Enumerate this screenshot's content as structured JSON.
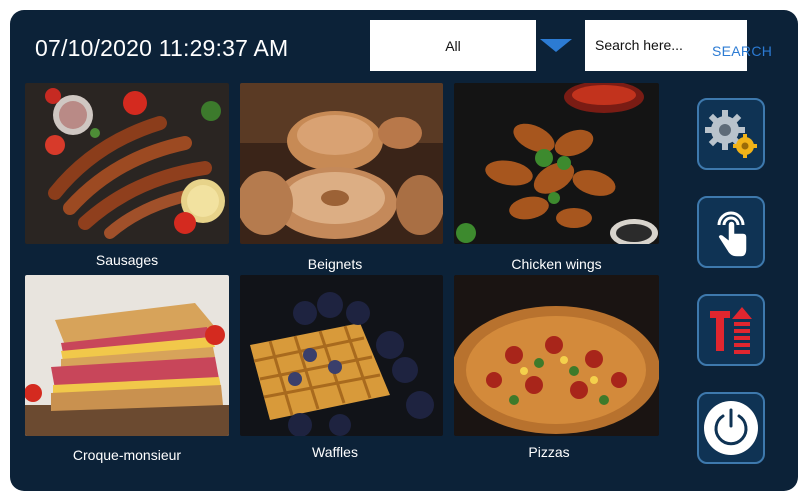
{
  "header": {
    "datetime": "07/10/2020 11:29:37 AM",
    "category_select": "All",
    "search_placeholder": "Search here...",
    "search_button": "SEARCH"
  },
  "menu_items": [
    {
      "label": "Sausages"
    },
    {
      "label": "Beignets"
    },
    {
      "label": "Chicken wings"
    },
    {
      "label": "Croque-monsieur"
    },
    {
      "label": "Waffles"
    },
    {
      "label": "Pizzas"
    }
  ],
  "side_buttons": [
    {
      "icon": "settings-gears-icon"
    },
    {
      "icon": "touch-hand-icon"
    },
    {
      "icon": "text-size-icon"
    },
    {
      "icon": "power-icon"
    }
  ],
  "colors": {
    "background": "#0c2238",
    "accent": "#2c7bd3",
    "button_border": "#3e79ad",
    "button_fill": "#0f3354",
    "text_size_icon": "#e0262f",
    "settings_gear_secondary": "#f2b318"
  }
}
